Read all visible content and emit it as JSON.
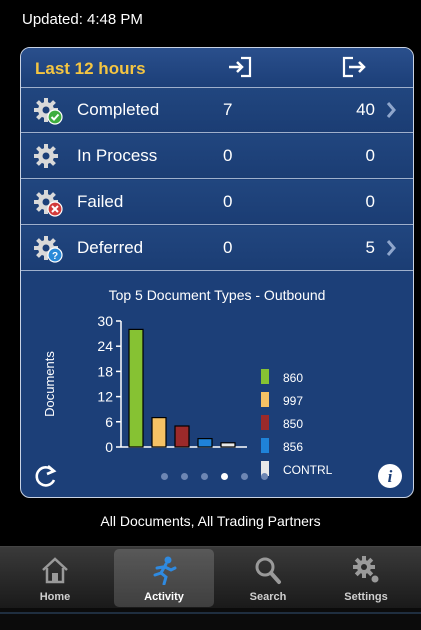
{
  "status": {
    "updated": "Updated: 4:48 PM"
  },
  "header": {
    "period": "Last 12 hours",
    "inbound_icon": "inbound-arrow-icon",
    "outbound_icon": "outbound-arrow-icon"
  },
  "rows": [
    {
      "label": "Completed",
      "inbound": "7",
      "outbound": "40",
      "has_chevron": true,
      "badge": "check",
      "badge_color": "#3fae3f"
    },
    {
      "label": "In Process",
      "inbound": "0",
      "outbound": "0",
      "has_chevron": false,
      "badge": "none",
      "badge_color": ""
    },
    {
      "label": "Failed",
      "inbound": "0",
      "outbound": "0",
      "has_chevron": false,
      "badge": "x",
      "badge_color": "#d23a3a"
    },
    {
      "label": "Deferred",
      "inbound": "0",
      "outbound": "5",
      "has_chevron": true,
      "badge": "question",
      "badge_color": "#2a8ad8"
    }
  ],
  "chart_data": {
    "type": "bar",
    "title": "Top 5 Document Types - Outbound",
    "ylabel": "Documents",
    "xlabel": "",
    "ylim": [
      0,
      30
    ],
    "yticks": [
      "0",
      "6",
      "12",
      "18",
      "24",
      "30"
    ],
    "categories": [
      "860",
      "997",
      "850",
      "856",
      "CONTRL"
    ],
    "values": [
      28,
      7,
      5,
      2,
      1
    ],
    "colors": [
      "#86c233",
      "#f6c265",
      "#9b2a2a",
      "#1f82d8",
      "#e8e8e8"
    ],
    "legend_position": "right",
    "grid": false
  },
  "pager": {
    "count": 6,
    "active_index": 3
  },
  "footer": {
    "scope": "All Documents, All Trading Partners"
  },
  "tabs": [
    {
      "label": "Home",
      "icon": "home-icon",
      "active": false
    },
    {
      "label": "Activity",
      "icon": "running-person-icon",
      "active": true
    },
    {
      "label": "Search",
      "icon": "search-icon",
      "active": false
    },
    {
      "label": "Settings",
      "icon": "gear-icon",
      "active": false
    }
  ]
}
